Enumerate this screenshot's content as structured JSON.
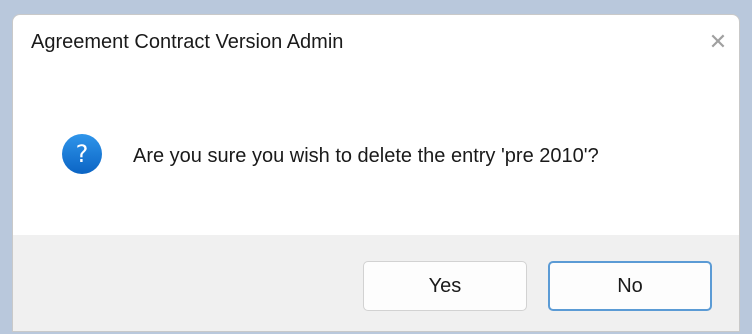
{
  "dialog": {
    "title": "Agreement Contract Version Admin",
    "close_glyph": "✕",
    "message": "Are you sure you wish to delete the entry 'pre 2010'?",
    "icon": "question-icon",
    "icon_glyph": "?",
    "buttons": {
      "yes_label": "Yes",
      "no_label": "No"
    }
  },
  "colors": {
    "accent": "#1a7fd9",
    "default_button_border": "#5b9bd5",
    "footer": "#f0f0f0",
    "desktop": "#b9c8dc"
  }
}
